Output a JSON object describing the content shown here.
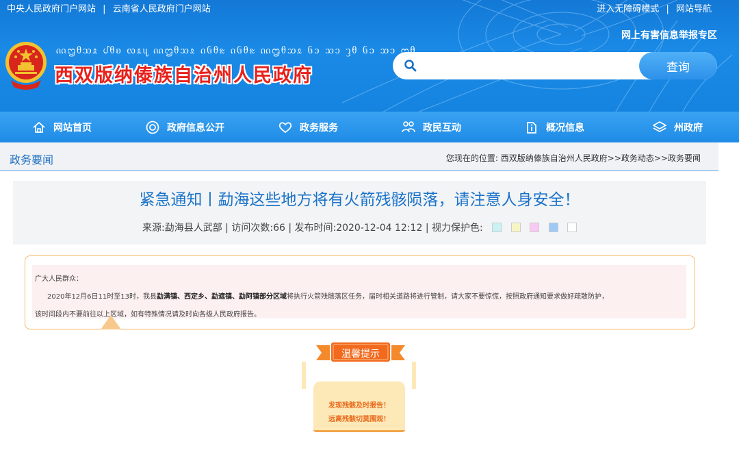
{
  "topbar": {
    "link_central": "中央人民政府门户网站",
    "link_yunnan": "云南省人民政府门户网站",
    "link_accessible": "进入无障碍模式",
    "link_sitemap": "网站导航",
    "separator": "|"
  },
  "header": {
    "dai_script": "ᦶᦗᦲᦉᦸ ᦔᦲᦈ ᦟᦸᦴ ᦶᦗᦲᦉᦸ ᦵᦑᦲᦰ ᦵᦑᦲᦰ ᦶᦗᦲᦉᦸ ᦑᦱ ᦉᦱ ᦡᦲ ᦑᦱ ᦉᦱ ᦗᦲ",
    "gov_name": "西双版纳傣族自治州人民政府",
    "report_link": "网上有害信息举报专区"
  },
  "search": {
    "placeholder": "",
    "value": "",
    "button": "查询"
  },
  "nav": [
    {
      "label": "网站首页",
      "icon": "home-icon"
    },
    {
      "label": "政府信息公开",
      "icon": "target-icon"
    },
    {
      "label": "政务服务",
      "icon": "heart-icon"
    },
    {
      "label": "政民互动",
      "icon": "people-icon"
    },
    {
      "label": "概况信息",
      "icon": "info-icon"
    },
    {
      "label": "州政府",
      "icon": "layers-icon"
    }
  ],
  "section": {
    "title": "政务要闻",
    "breadcrumb": "您现在的位置:  西双版纳傣族自治州人民政府>>政务动态>>政务要闻"
  },
  "article": {
    "title": "紧急通知丨勐海这些地方将有火箭残骸陨落，请注意人身安全！",
    "meta": "来源:勐海县人武部  | 访问次数:66  | 发布时间:2020-12-04 12:12 | 视力保护色:"
  },
  "swatches": [
    "#c9f2f5",
    "#f8f5c4",
    "#f8c9f3",
    "#9dc9f5",
    "#ffffff"
  ],
  "notice": {
    "greeting": "广大人民群众：",
    "line1_a": "2020年12月6日11时至13时，我县",
    "line1_bold": "勐满镇、西定乡、勐遮镇、勐阿镇部分区域",
    "line1_b": "将执行火箭残骸落区任务，届时相关道路将进行管制，请大家不要惊慌，按照政府通知要求做好疏散防护，",
    "line2": "该时间段内不要前往以上区域，如有特殊情况请及时向各级人民政府报告。"
  },
  "tips": {
    "ribbon": "温馨提示",
    "line1": "发现残骸及时报告！",
    "line2": "远离残骸切莫围观！"
  },
  "colors": {
    "header_blue": "#1584e0",
    "nav_blue": "#2892ea",
    "title_red": "#e8211b",
    "link_blue": "#1a73c9",
    "orange": "#f48a2c"
  }
}
